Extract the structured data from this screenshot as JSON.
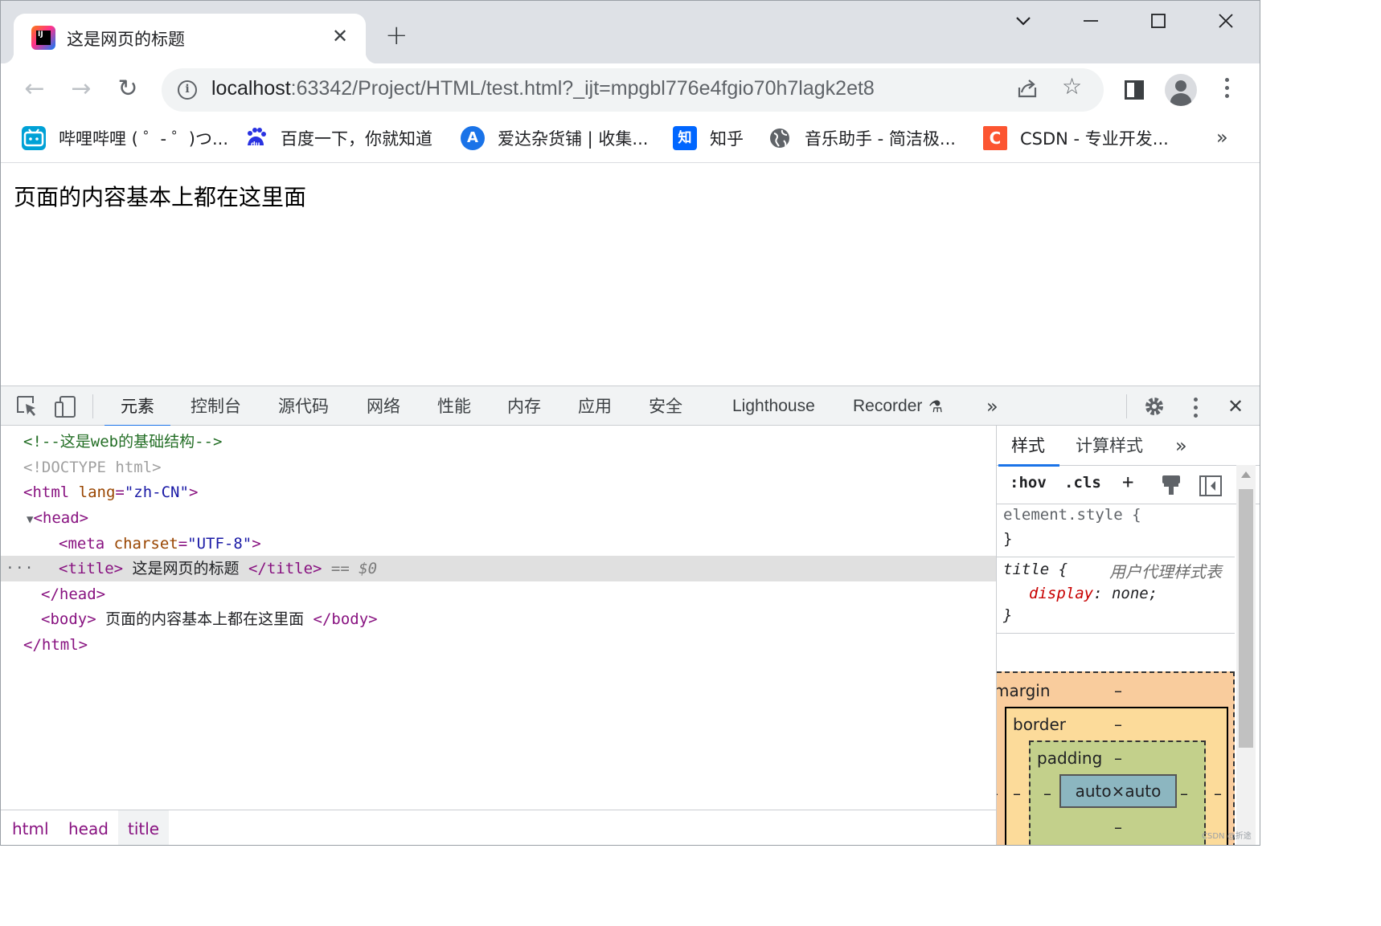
{
  "tab": {
    "title": "这是网页的标题",
    "favicon_text": "IJ",
    "close": "✕",
    "new_tab": "+"
  },
  "window": {
    "tab_search": "⌄",
    "minimize": "—",
    "maximize": "☐",
    "close": "✕"
  },
  "address": {
    "host": "localhost",
    "path": ":63342/Project/HTML/test.html?_ijt=mpgbl776e4fgio70h7lagk2et8"
  },
  "toolbar": {
    "back": "←",
    "forward": "→",
    "reload": "↻",
    "share": "⇪",
    "star": "☆"
  },
  "bookmarks": [
    {
      "label": "哔哩哔哩 ( ゜- ゜)つ...",
      "icon": "bilibili-icon",
      "color": "#00a1d6",
      "glyph": "▭"
    },
    {
      "label": "百度一下，你就知道",
      "icon": "baidu-icon",
      "color": "#2932e1",
      "glyph": "du"
    },
    {
      "label": "爱达杂货铺 | 收集...",
      "icon": "aida-icon",
      "color": "#1a73e8",
      "glyph": "A"
    },
    {
      "label": "知乎",
      "icon": "zhihu-icon",
      "color": "#0066ff",
      "glyph": "知"
    },
    {
      "label": "音乐助手 - 简洁极...",
      "icon": "globe-icon",
      "color": "#5f6368",
      "glyph": "◍"
    },
    {
      "label": "CSDN - 专业开发...",
      "icon": "csdn-icon",
      "color": "#fc5531",
      "glyph": "C"
    }
  ],
  "bookmarks_more": "»",
  "page": {
    "body_text": "页面的内容基本上都在这里面"
  },
  "devtools": {
    "tabs": [
      "元素",
      "控制台",
      "源代码",
      "网络",
      "性能",
      "内存",
      "应用",
      "安全",
      "Lighthouse",
      "Recorder"
    ],
    "recorder_flask": "⚗",
    "more_tabs": "»",
    "close": "✕",
    "elements": {
      "comment": "<!--这是web的基础结构-->",
      "doctype": "<!DOCTYPE html>",
      "html_open_tag": "<html",
      "lang_attr": " lang",
      "lang_value": "\"zh-CN\"",
      "tag_close": ">",
      "head_open": "<head>",
      "meta_tag": "<meta",
      "charset_attr": " charset",
      "charset_value": "\"UTF-8\"",
      "title_open": "<title>",
      "title_text": " 这是网页的标题 ",
      "title_close": "</title>",
      "selected_marker": " == $0",
      "head_close": "</head>",
      "body_open": "<body>",
      "body_text": " 页面的内容基本上都在这里面 ",
      "body_close": "</body>",
      "html_close": "</html>",
      "equals": "=",
      "row_dots": "···",
      "expand_triangle": "▼"
    },
    "breadcrumbs": [
      "html",
      "head",
      "title"
    ],
    "styles": {
      "tabs": [
        "样式",
        "计算样式"
      ],
      "more": "»",
      "hov": ":hov",
      "cls": ".cls",
      "add": "+",
      "element_style": "element.style {",
      "close_brace": "}",
      "title_selector": "title {",
      "ua_label": "用户代理样式表",
      "prop_name": "display",
      "prop_value": ": none;",
      "box": {
        "margin": "margin",
        "border": "border",
        "padding": "padding",
        "content": "auto×auto",
        "dash": "–"
      }
    }
  },
  "watermark": "CSDN @折途"
}
